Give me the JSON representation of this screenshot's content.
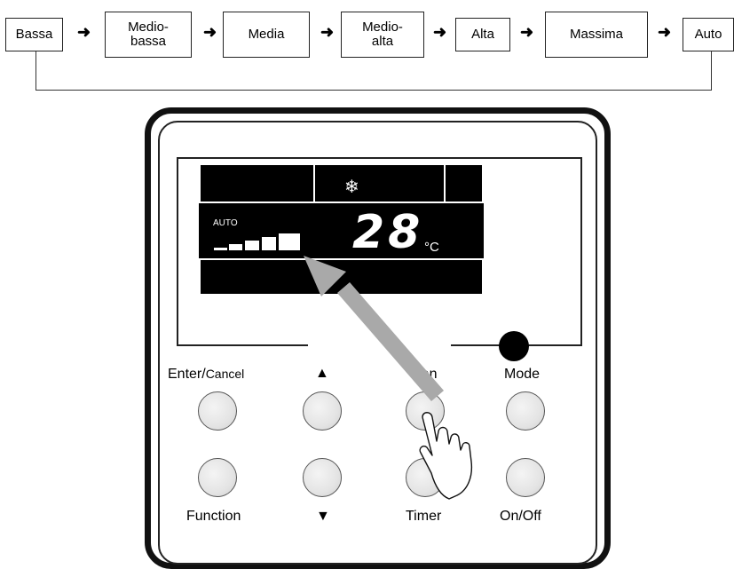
{
  "flow": {
    "steps": [
      {
        "line1": "Bassa",
        "line2": ""
      },
      {
        "line1": "Medio-",
        "line2": "bassa"
      },
      {
        "line1": "Media",
        "line2": ""
      },
      {
        "line1": "Medio-",
        "line2": "alta"
      },
      {
        "line1": "Alta",
        "line2": ""
      },
      {
        "line1": "Massima",
        "line2": ""
      },
      {
        "line1": "Auto",
        "line2": ""
      }
    ],
    "arrow": "➜"
  },
  "controller": {
    "display": {
      "mode_icon": "snowflake-icon",
      "fan_auto_label": "AUTO",
      "temperature": "28",
      "unit": "°C"
    },
    "buttons": {
      "enter_cancel": {
        "main": "Enter/",
        "sub": "Cancel"
      },
      "up": "▲",
      "fan": "Fan",
      "mode": "Mode",
      "function": "Function",
      "down": "▼",
      "timer": "Timer",
      "on_off": "On/Off"
    }
  }
}
